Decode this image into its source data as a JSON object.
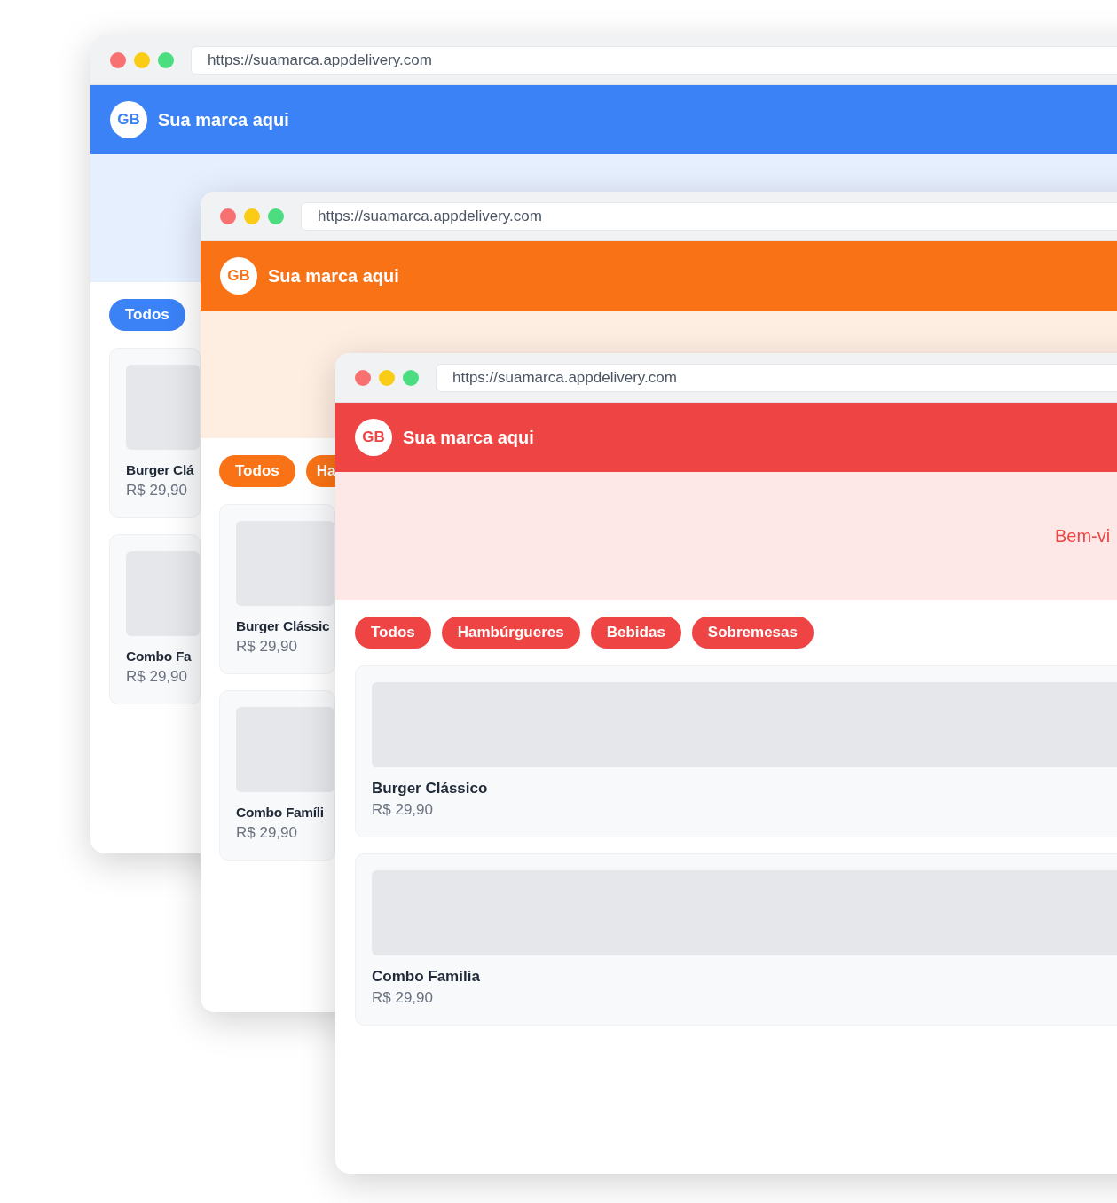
{
  "windows": [
    {
      "color": "#3b82f6",
      "url": "https://suamarca.appdelivery.com",
      "logo": "GB",
      "brand": "Sua marca aqui",
      "categories": [
        "Todos"
      ],
      "products": [
        {
          "name": "Burger Clá",
          "price": "R$ 29,90"
        },
        {
          "name": "Combo Fa",
          "price": "R$ 29,90"
        }
      ]
    },
    {
      "color": "#f97316",
      "url": "https://suamarca.appdelivery.com",
      "logo": "GB",
      "brand": "Sua marca aqui",
      "categories": [
        "Todos",
        "Ha"
      ],
      "products": [
        {
          "name": "Burger Clássic",
          "price": "R$ 29,90"
        },
        {
          "name": "Combo Famíli",
          "price": "R$ 29,90"
        }
      ]
    },
    {
      "color": "#ef4444",
      "url": "https://suamarca.appdelivery.com",
      "logo": "GB",
      "brand": "Sua marca aqui",
      "hero_text": "Bem-vi",
      "categories": [
        "Todos",
        "Hambúrgueres",
        "Bebidas",
        "Sobremesas"
      ],
      "products": [
        {
          "name": "Burger Clássico",
          "price": "R$ 29,90"
        },
        {
          "name": "Combo Família",
          "price": "R$ 29,90"
        }
      ]
    }
  ]
}
